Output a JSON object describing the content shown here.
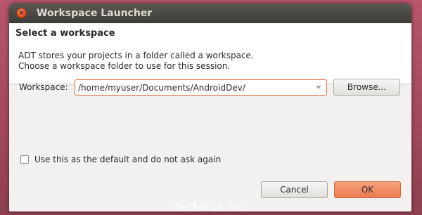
{
  "window": {
    "title": "Workspace Launcher",
    "close_glyph": "×"
  },
  "header": {
    "heading": "Select a workspace",
    "desc_line1": "ADT stores your projects in a folder called a workspace.",
    "desc_line2": "Choose a workspace folder to use for this session."
  },
  "workspace": {
    "label": "Workspace:",
    "value": "/home/myuser/Documents/AndroidDev/",
    "browse_label": "Browse..."
  },
  "default_option": {
    "label": "Use this as the default and do not ask again",
    "checked": false
  },
  "buttons": {
    "cancel": "Cancel",
    "ok": "OK"
  },
  "watermark": "TecAdmin.net",
  "colors": {
    "accent": "#ef7b50",
    "titlebar": "#3c3b37",
    "focus_border": "#e06a3a"
  }
}
